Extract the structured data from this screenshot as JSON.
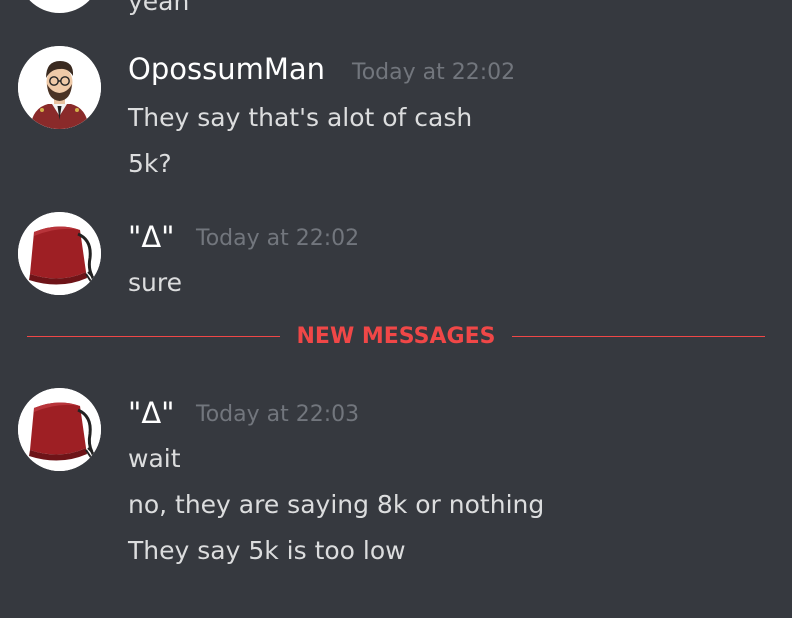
{
  "top_partial": {
    "message": "yeah"
  },
  "groups": [
    {
      "author": "OpossumMan",
      "avatar_icon": "bearded-man-avatar-icon",
      "timestamp": "Today at 22:02",
      "messages": [
        "They say that's alot of cash",
        "5k?"
      ]
    },
    {
      "author": "\"Δ\"",
      "avatar_icon": "red-fez-avatar-icon",
      "timestamp": "Today at 22:02",
      "messages": [
        "sure"
      ]
    },
    {
      "author": "\"Δ\"",
      "avatar_icon": "red-fez-avatar-icon",
      "timestamp": "Today at 22:03",
      "messages": [
        "wait",
        "no, they are saying 8k or nothing",
        "They say 5k is too low"
      ]
    }
  ],
  "divider": {
    "label": "NEW MESSAGES"
  },
  "colors": {
    "background": "#36393f",
    "username": "#ffffff",
    "timestamp": "#72767d",
    "message_text": "#dcddde",
    "new_messages_accent": "#f04747"
  }
}
